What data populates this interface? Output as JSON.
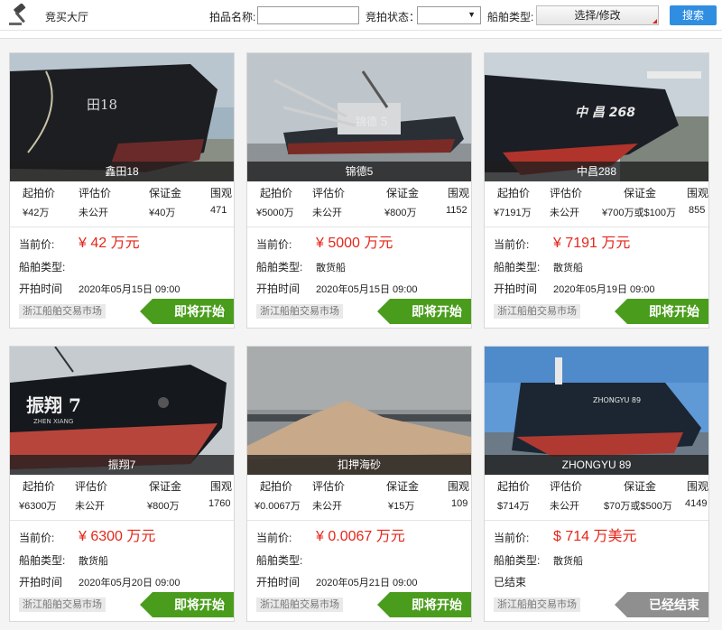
{
  "header": {
    "title": "竞买大厅",
    "name_label": "拍品名称:",
    "name_value": "",
    "status_label": "竞拍状态：",
    "status_value": "",
    "type_label": "船舶类型:",
    "choose_label": "选择/修改",
    "search_label": "搜索"
  },
  "table_headers": {
    "start": "起拍价",
    "estimate": "评估价",
    "deposit": "保证金",
    "views": "围观"
  },
  "labels": {
    "current": "当前价:",
    "ship_type": "船舶类型:",
    "start_time": "开拍时间"
  },
  "cards": [
    {
      "name": "鑫田18",
      "start": "¥42万",
      "estimate": "未公开",
      "deposit": "¥40万",
      "views": "471",
      "price": "¥ 42 万元",
      "ship_type": "",
      "time": "2020年05月15日 09:00",
      "market": "浙江船舶交易市场",
      "status": "即将开始",
      "status_color": "green"
    },
    {
      "name": "锦德5",
      "start": "¥5000万",
      "estimate": "未公开",
      "deposit": "¥800万",
      "views": "1152",
      "price": "¥ 5000 万元",
      "ship_type": "散货船",
      "time": "2020年05月15日 09:00",
      "market": "浙江船舶交易市场",
      "status": "即将开始",
      "status_color": "green"
    },
    {
      "name": "中昌288",
      "start": "¥7191万",
      "estimate": "未公开",
      "deposit": "¥700万或$100万",
      "views": "855",
      "price": "¥ 7191 万元",
      "ship_type": "散货船",
      "time": "2020年05月19日 09:00",
      "market": "浙江船舶交易市场",
      "status": "即将开始",
      "status_color": "green"
    },
    {
      "name": "振翔7",
      "start": "¥6300万",
      "estimate": "未公开",
      "deposit": "¥800万",
      "views": "1760",
      "price": "¥ 6300 万元",
      "ship_type": "散货船",
      "time": "2020年05月20日 09:00",
      "market": "浙江船舶交易市场",
      "status": "即将开始",
      "status_color": "green"
    },
    {
      "name": "扣押海砂",
      "start": "¥0.0067万",
      "estimate": "未公开",
      "deposit": "¥15万",
      "views": "109",
      "price": "¥ 0.0067 万元",
      "ship_type": "",
      "time": "2020年05月21日 09:00",
      "market": "浙江船舶交易市场",
      "status": "即将开始",
      "status_color": "green"
    },
    {
      "name": "ZHONGYU 89",
      "start": "$714万",
      "estimate": "未公开",
      "deposit": "$70万或$500万",
      "views": "4149",
      "price": "$ 714 万美元",
      "ship_type": "散货船",
      "time": "已结束",
      "market": "浙江船舶交易市场",
      "status": "已经结束",
      "status_color": "gray"
    }
  ],
  "colors": {
    "accent_red": "#e4261b",
    "badge_green": "#4a9d1c",
    "badge_gray": "#8f8f8f",
    "search_blue": "#2f8ee0"
  }
}
